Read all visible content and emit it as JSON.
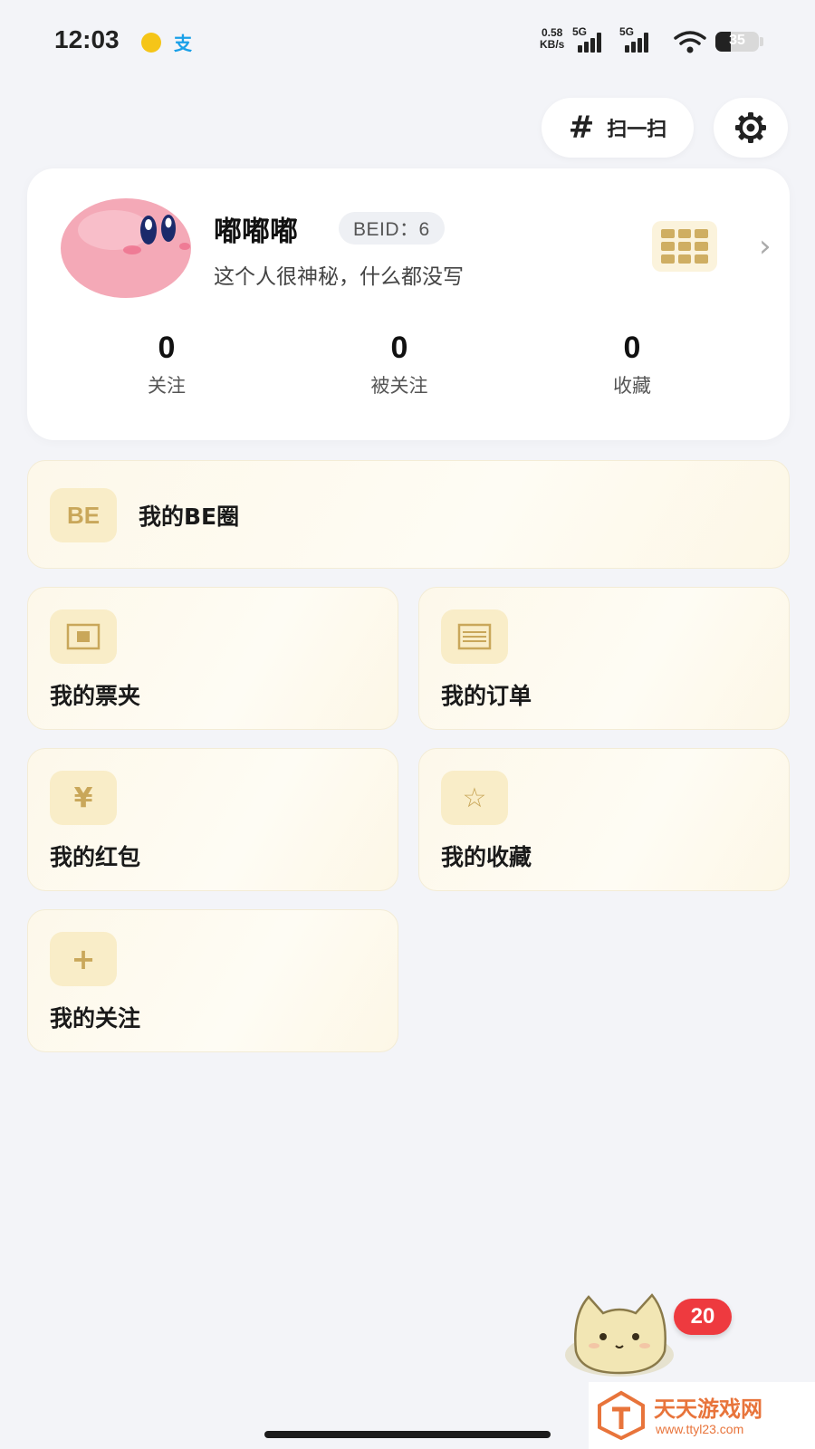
{
  "status_bar": {
    "time": "12:03",
    "net_speed": "0.58",
    "net_unit": "KB/s",
    "sim1": "5G",
    "sim2": "5G",
    "battery": "35",
    "battery_level": 0.35
  },
  "header": {
    "scan_label": "扫一扫"
  },
  "profile": {
    "username": "嘟嘟嘟",
    "beid": "BEID：6",
    "bio": "这个人很神秘，什么都没写",
    "stats": [
      {
        "value": "0",
        "label": "关注"
      },
      {
        "value": "0",
        "label": "被关注"
      },
      {
        "value": "0",
        "label": "收藏"
      }
    ]
  },
  "menu": {
    "be_circle": {
      "icon_text": "BE",
      "label": "我的BE圈"
    },
    "items": [
      {
        "label": "我的票夹",
        "icon": "ticket-icon"
      },
      {
        "label": "我的订单",
        "icon": "order-list-icon"
      },
      {
        "label": "我的红包",
        "icon": "yen-icon",
        "icon_text": "¥"
      },
      {
        "label": "我的收藏",
        "icon": "star-icon",
        "icon_text": "☆"
      },
      {
        "label": "我的关注",
        "icon": "plus-icon",
        "icon_text": "+"
      }
    ]
  },
  "floating": {
    "badge_count": "20"
  },
  "watermark": {
    "title": "天天游戏网",
    "url": "www.ttyl23.com"
  },
  "colors": {
    "accent_gold": "#c9a75a",
    "card_cream": "#fdf8ea",
    "badge_red": "#ee3a3f"
  }
}
